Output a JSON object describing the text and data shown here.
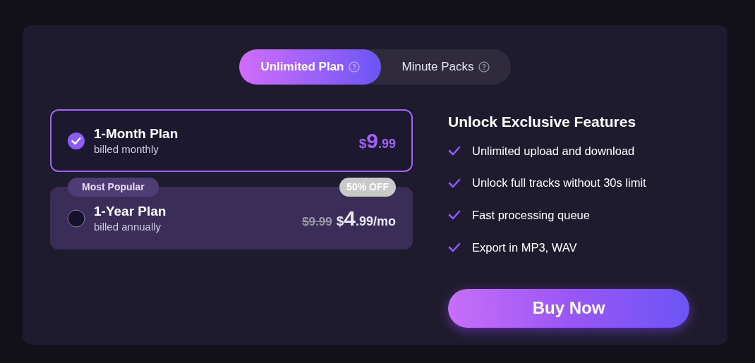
{
  "tabs": [
    {
      "label": "Unlimited Plan",
      "selected": true
    },
    {
      "label": "Minute Packs",
      "selected": false
    }
  ],
  "plans": [
    {
      "name": "1-Month Plan",
      "billing": "billed monthly",
      "selected": true,
      "price": {
        "currency": "$",
        "whole": "9",
        "cents": ".99"
      }
    },
    {
      "name": "1-Year Plan",
      "billing": "billed annually",
      "selected": false,
      "badge": "Most Popular",
      "discount": "50% OFF",
      "old_price": "$9.99",
      "price": {
        "currency": "$",
        "whole": "4",
        "cents": ".99",
        "suffix": "/mo"
      }
    }
  ],
  "features": {
    "title": "Unlock Exclusive Features",
    "items": [
      "Unlimited upload and download",
      "Unlock full tracks without 30s limit",
      "Fast processing queue",
      "Export in MP3, WAV"
    ]
  },
  "buy_button": "Buy Now"
}
